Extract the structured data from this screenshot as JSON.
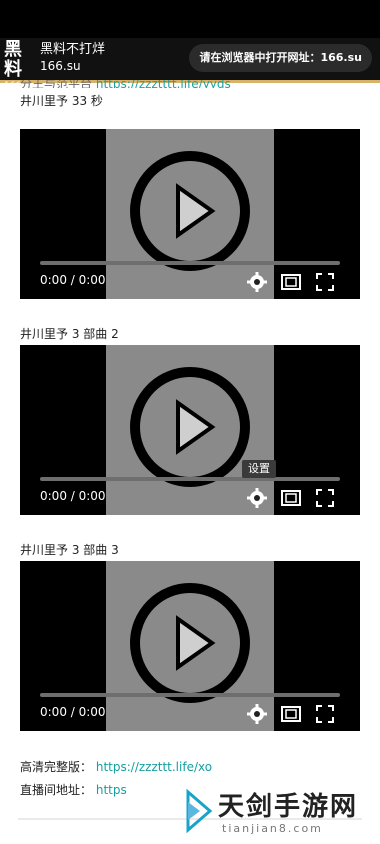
{
  "header": {
    "logo_text": "黑料",
    "logo_domain": "166.su",
    "site_title": "黑料不打烊",
    "site_domain": "166.su",
    "visit_button": "请在浏览器中打开网址：166.su"
  },
  "partial_top": {
    "text": "分王与范平台",
    "link": "https://zzztttt.life/yyds"
  },
  "videos": [
    {
      "title": "井川里予 33 秒",
      "time": "0:00 / 0:00"
    },
    {
      "title": "井川里予 3 部曲 2",
      "time": "0:00 / 0:00",
      "tooltip": "设置"
    },
    {
      "title": "井川里予 3 部曲 3",
      "time": "0:00 / 0:00"
    }
  ],
  "footer": {
    "hd_label": "高清完整版：",
    "hd_link": "https://zzzttt.life/xo",
    "live_label": "直播间地址：",
    "live_link": "https"
  },
  "watermark": {
    "title": "天剑手游网",
    "subtitle": "tianjian8.com"
  },
  "colors": {
    "accent": "#d7b36a",
    "link": "#14a0a0"
  }
}
